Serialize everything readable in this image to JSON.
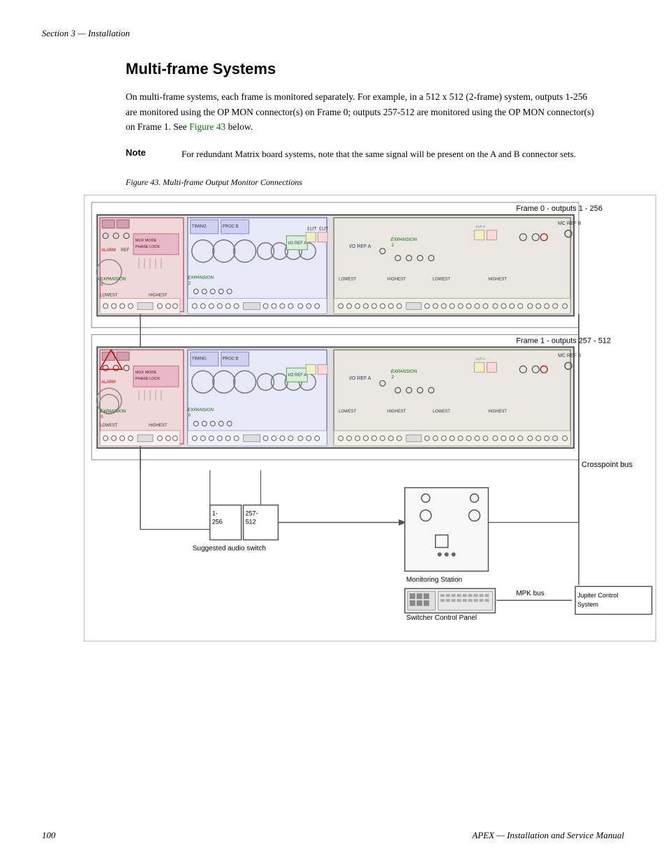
{
  "section_label": "Section 3 — Installation",
  "heading": "Multi-frame Systems",
  "body_paragraph": "On multi-frame systems, each frame is monitored separately. For example, in a 512 x 512 (2-frame) system, outputs 1-256 are monitored using the OP MON connector(s) on Frame 0; outputs 257-512 are monitored using the OP MON connector(s) on Frame 1. See Figure 43 below.",
  "figure_link": "Figure 43",
  "note_label": "Note",
  "note_text": "For redundant Matrix board systems, note that the same signal will be present on the A and B connector sets.",
  "figure_caption": "Figure 43.  Multi-frame Output Monitor Connections",
  "frame0_label": "Frame 0 - outputs 1 - 256",
  "frame1_label": "Frame 1 - outputs 257 - 512",
  "crosspoint_bus_label": "Crosspoint bus",
  "audio_switch_label": "Suggested audio switch",
  "monitoring_station_label": "Monitoring Station",
  "mpk_bus_label": "MPK bus",
  "switcher_panel_label": "Switcher Control Panel",
  "jupiter_label": "Jupiter Control System",
  "outputs_1_256": "1-\n256",
  "outputs_257_512": "257-\n512",
  "page_number": "100",
  "manual_title": "APEX — Installation and Service Manual"
}
